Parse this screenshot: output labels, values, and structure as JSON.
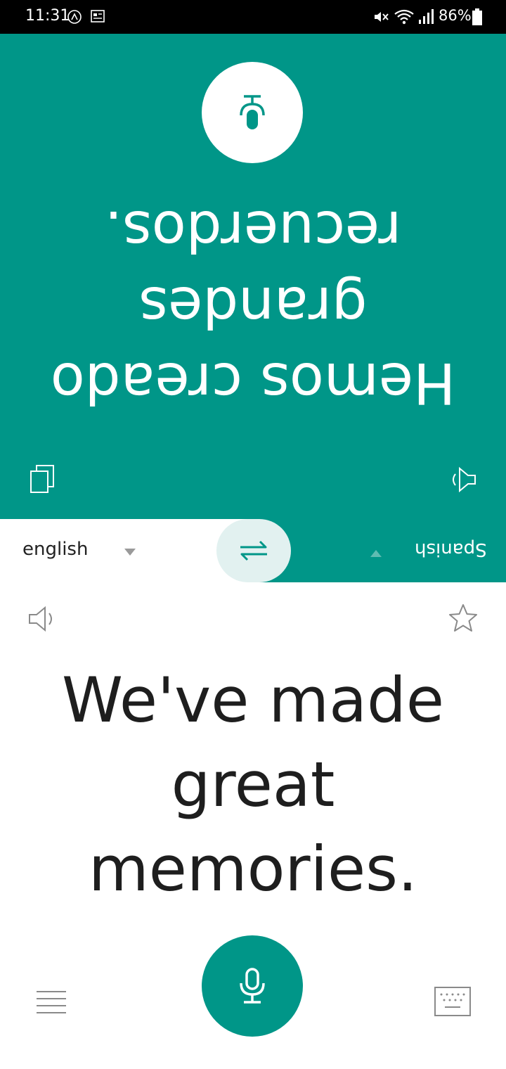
{
  "status_bar": {
    "time": "11:31",
    "battery": "86%",
    "left_icons": [
      "nfc-icon",
      "news-icon"
    ],
    "right_icons": [
      "mute-icon",
      "wifi-icon",
      "signal-icon",
      "battery-icon"
    ]
  },
  "translation_panel": {
    "translated_text": "Hemos creado grandes recuerdos.",
    "orientation": "upside-down",
    "background_color": "#009688"
  },
  "language_bar": {
    "source_language": "english",
    "target_language": "Spanish"
  },
  "source_panel": {
    "source_text": "We've made great memories."
  },
  "colors": {
    "accent": "#009688",
    "swap_button_bg": "#e2f1f0",
    "text_dark": "#1e1e1e",
    "icon_gray": "#8a8a8a"
  }
}
